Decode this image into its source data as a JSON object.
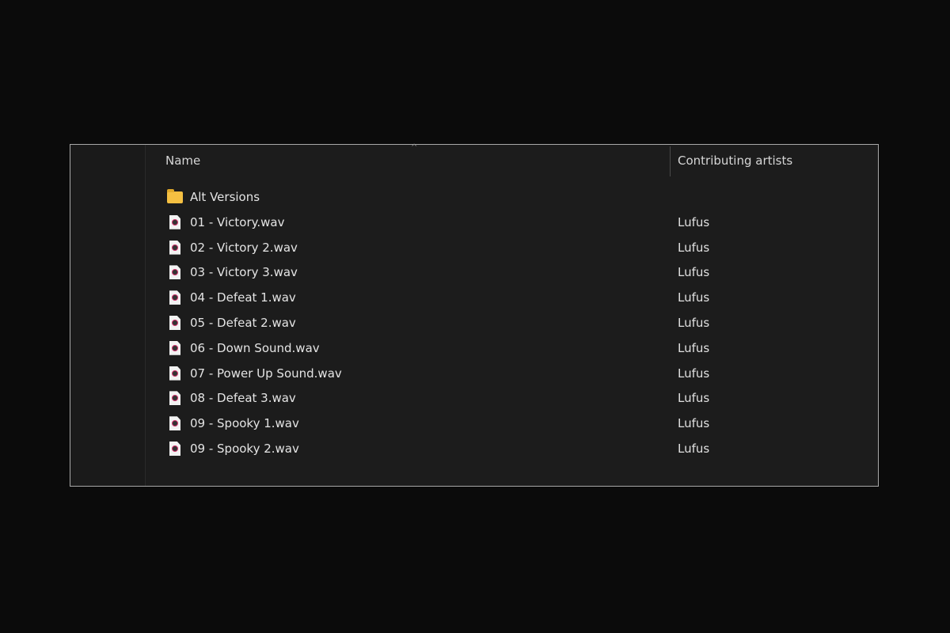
{
  "columns": {
    "name": "Name",
    "artist": "Contributing artists"
  },
  "rows": [
    {
      "name": "Alt Versions",
      "type": "folder",
      "artist": ""
    },
    {
      "name": "01 - Victory.wav",
      "type": "audio",
      "artist": "Lufus"
    },
    {
      "name": "02 - Victory 2.wav",
      "type": "audio",
      "artist": "Lufus"
    },
    {
      "name": "03 - Victory 3.wav",
      "type": "audio",
      "artist": "Lufus"
    },
    {
      "name": "04 - Defeat 1.wav",
      "type": "audio",
      "artist": "Lufus"
    },
    {
      "name": "05 - Defeat 2.wav",
      "type": "audio",
      "artist": "Lufus"
    },
    {
      "name": "06 - Down Sound.wav",
      "type": "audio",
      "artist": "Lufus"
    },
    {
      "name": "07 - Power Up Sound.wav",
      "type": "audio",
      "artist": "Lufus"
    },
    {
      "name": "08 - Defeat 3.wav",
      "type": "audio",
      "artist": "Lufus"
    },
    {
      "name": "09 - Spooky 1.wav",
      "type": "audio",
      "artist": "Lufus"
    },
    {
      "name": "09 - Spooky 2.wav",
      "type": "audio",
      "artist": "Lufus"
    }
  ]
}
